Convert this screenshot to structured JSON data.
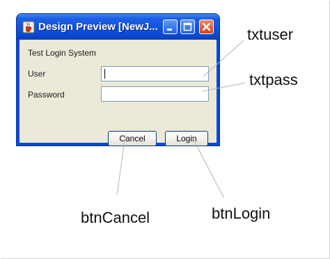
{
  "window": {
    "title": "Design Preview [NewJ...",
    "controls": [
      "minimize-icon",
      "maximize-icon",
      "close-icon"
    ]
  },
  "form": {
    "heading": "Test Login System",
    "user_label": "User",
    "user_value": "",
    "password_label": "Password",
    "password_value": "",
    "cancel_label": "Cancel",
    "login_label": "Login"
  },
  "callouts": {
    "txtuser": "txtuser",
    "txtpass": "txtpass",
    "btncancel": "btnCancel",
    "btnlogin": "btnLogin"
  },
  "colors": {
    "titlebar": "#0c52e2",
    "client": "#ece9d8",
    "field_border": "#7f9db9",
    "button_border": "#003c74",
    "close_button": "#d2411c"
  }
}
